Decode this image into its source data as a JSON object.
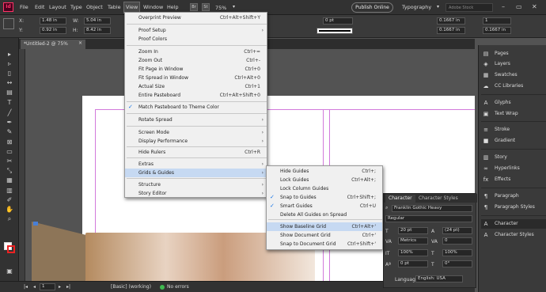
{
  "app": {
    "logo": "Id",
    "menus": [
      "File",
      "Edit",
      "Layout",
      "Type",
      "Object",
      "Table",
      "View",
      "Window",
      "Help"
    ],
    "zoom": "75%",
    "publish": "Publish Online",
    "workspace": "Typography",
    "search_placeholder": "Adobe Stock",
    "window_controls": [
      "–",
      "▭",
      "✕"
    ]
  },
  "control": {
    "x_label": "X:",
    "x_val": "1.48 in",
    "y_label": "Y:",
    "y_val": "0.92 in",
    "w_label": "W:",
    "w_val": "5.04 in",
    "h_label": "H:",
    "h_val": "8.42 in",
    "stroke": "0 pt",
    "r1": "0.1667 in",
    "r2": "0.1667 in",
    "r3": "1",
    "r4": "0.1667 in"
  },
  "doc": {
    "tab": "*Untitled-2 @ 75%",
    "close": "×"
  },
  "view_menu": {
    "items": [
      {
        "label": "Overprint Preview",
        "shortcut": "Ctrl+Alt+Shift+Y"
      },
      {
        "label": "Proof Setup",
        "arrow": "›"
      },
      {
        "label": "Proof Colors"
      },
      {
        "label": "Zoom In",
        "shortcut": "Ctrl+="
      },
      {
        "label": "Zoom Out",
        "shortcut": "Ctrl+-"
      },
      {
        "label": "Fit Page in Window",
        "shortcut": "Ctrl+0"
      },
      {
        "label": "Fit Spread in Window",
        "shortcut": "Ctrl+Alt+0"
      },
      {
        "label": "Actual Size",
        "shortcut": "Ctrl+1"
      },
      {
        "label": "Entire Pasteboard",
        "shortcut": "Ctrl+Alt+Shift+0"
      },
      {
        "label": "Match Pasteboard to Theme Color",
        "check": "✓"
      },
      {
        "label": "Rotate Spread",
        "arrow": "›"
      },
      {
        "label": "Screen Mode",
        "arrow": "›"
      },
      {
        "label": "Display Performance",
        "arrow": "›"
      },
      {
        "label": "Hide Rulers",
        "shortcut": "Ctrl+R"
      },
      {
        "label": "Extras",
        "arrow": "›"
      },
      {
        "label": "Grids & Guides",
        "arrow": "›"
      },
      {
        "label": "Structure",
        "arrow": "›"
      },
      {
        "label": "Story Editor",
        "arrow": "›"
      }
    ]
  },
  "grids_menu": {
    "items": [
      {
        "label": "Hide Guides",
        "shortcut": "Ctrl+;"
      },
      {
        "label": "Lock Guides",
        "shortcut": "Ctrl+Alt+;"
      },
      {
        "label": "Lock Column Guides"
      },
      {
        "label": "Snap to Guides",
        "shortcut": "Ctrl+Shift+;",
        "check": "✓"
      },
      {
        "label": "Smart Guides",
        "shortcut": "Ctrl+U",
        "check": "✓"
      },
      {
        "label": "Delete All Guides on Spread"
      },
      {
        "label": "Show Baseline Grid",
        "shortcut": "Ctrl+Alt+'"
      },
      {
        "label": "Show Document Grid",
        "shortcut": "Ctrl+'"
      },
      {
        "label": "Snap to Document Grid",
        "shortcut": "Ctrl+Shift+'"
      }
    ]
  },
  "right_panel": {
    "items": [
      "Pages",
      "Layers",
      "Swatches",
      "CC Libraries",
      "Glyphs",
      "Text Wrap",
      "Stroke",
      "Gradient",
      "Story",
      "Hyperlinks",
      "Effects",
      "Paragraph",
      "Paragraph Styles",
      "Character",
      "Character Styles"
    ],
    "icons": [
      "▤",
      "◈",
      "▦",
      "☁",
      "A",
      "▣",
      "≡",
      "■",
      "▥",
      "∞",
      "fx",
      "¶",
      "¶",
      "A",
      "A"
    ]
  },
  "char_panel": {
    "tab1": "Character",
    "tab2": "Character Styles",
    "font": "Franklin Gothic Heavy",
    "style": "Regular",
    "size": "20 pt",
    "leading": "(24 pt)",
    "kerning": "Metrics",
    "tracking": "0",
    "vscale": "100%",
    "hscale": "100%",
    "baseline": "0 pt",
    "skew": "0°",
    "lang_label": "Language:",
    "lang": "English: USA"
  },
  "status": {
    "page": "1",
    "preflight_profile": "[Basic] (working)",
    "errors": "No errors"
  },
  "colors": {
    "accent": "#1473e6",
    "menu_bg": "#f0f0f0",
    "margin_guide": "#d27adb"
  }
}
